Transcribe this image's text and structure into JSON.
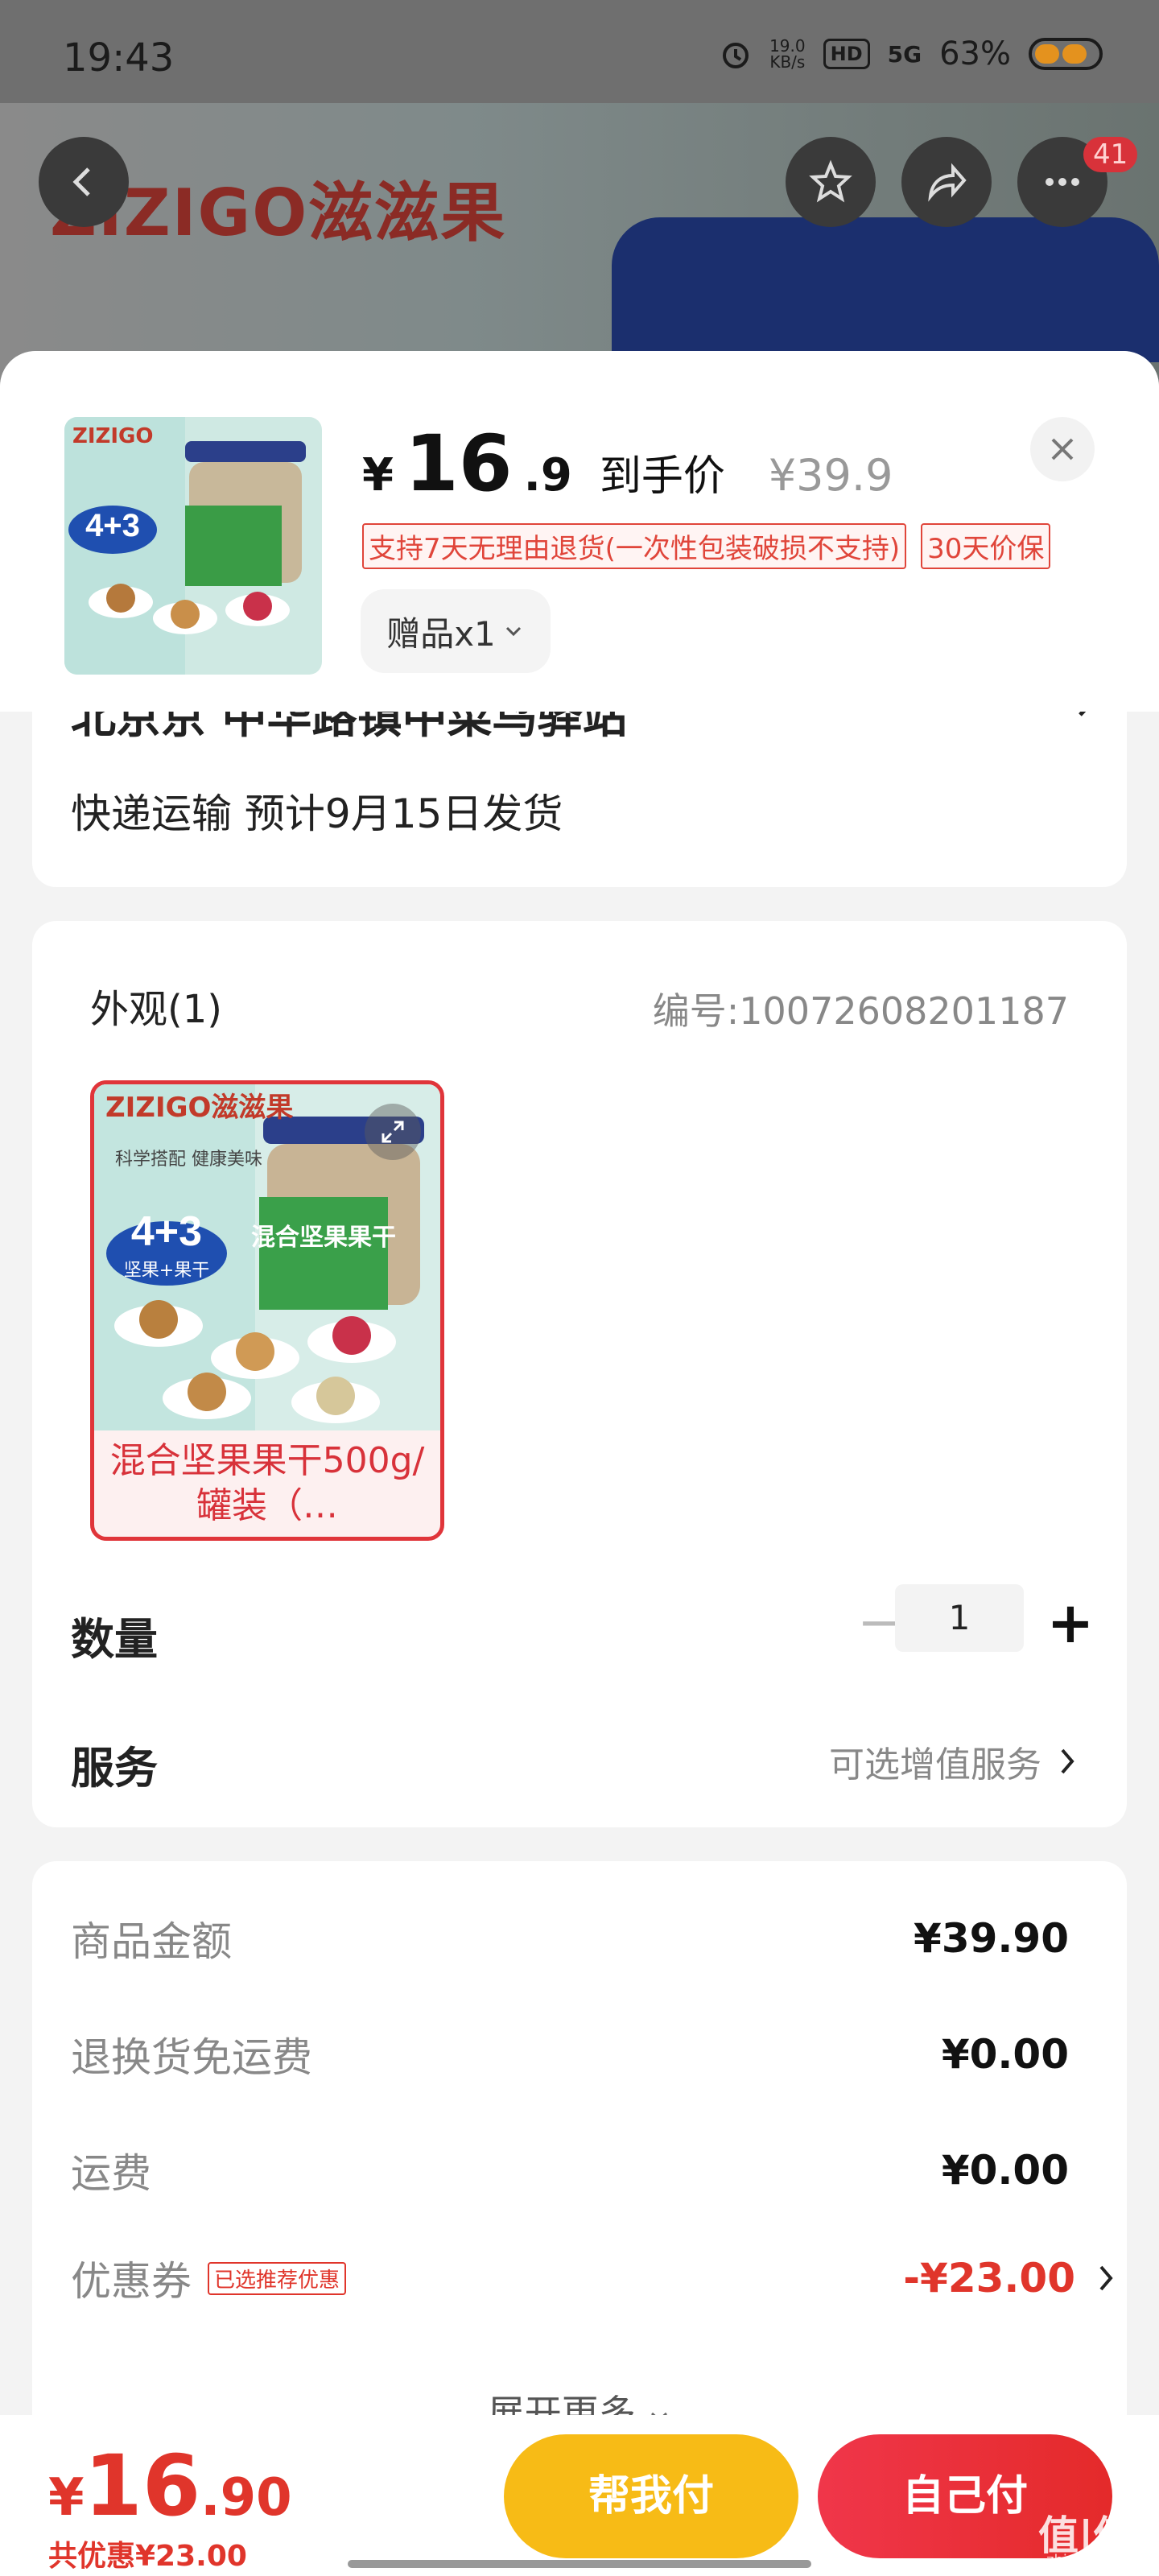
{
  "status": {
    "time": "19:43",
    "net_speed": "19.0\nKB/s",
    "hd": "HD",
    "signal": "5G",
    "battery": "63%"
  },
  "background": {
    "brand": "ZIZIGO滋滋果",
    "notify_count": "41"
  },
  "header": {
    "currency": "¥",
    "price_int": "16",
    "price_dec": ".9",
    "price_label": "到手价",
    "original_price": "¥39.9",
    "tags": [
      "支持7天无理由退货(一次性包装破损不支持)",
      "30天价保"
    ],
    "gift": "赠品x1"
  },
  "address": {
    "line": "北京京 中华路镇中菜鸟驿站",
    "shipping": "快递运输 预计9月15日发货"
  },
  "spec": {
    "title": "外观(1)",
    "code": "编号:10072608201187",
    "variant_label": "混合坚果果干500g/罐装（…",
    "image_brand": "ZIZIGO滋滋果",
    "image_slogan": "科学搭配 健康美味",
    "image_big": "4+3",
    "image_sub": "坚果+果干",
    "image_box": "混合坚果果干",
    "qty_label": "数量",
    "qty_value": "1",
    "minus": "−",
    "plus": "+",
    "service_label": "服务",
    "service_value": "可选增值服务"
  },
  "fees": [
    {
      "label": "商品金额",
      "value": "¥39.90"
    },
    {
      "label": "退换货免运费",
      "value": "¥0.00"
    },
    {
      "label": "运费",
      "value": "¥0.00"
    },
    {
      "label": "优惠券",
      "badge": "已选推荐优惠",
      "value": "-¥23.00"
    }
  ],
  "expand_more": "展开更多",
  "footer": {
    "currency": "¥",
    "price_int": "16",
    "price_dec": ".90",
    "savings": "共优惠¥23.00",
    "help_pay": "帮我付",
    "self_pay": "自己付"
  },
  "watermark": "值|值|值",
  "watermark_url": "zhizhizhi.com",
  "colors": {
    "accent_red": "#e0352b",
    "help_yellow": "#f7bb16"
  }
}
